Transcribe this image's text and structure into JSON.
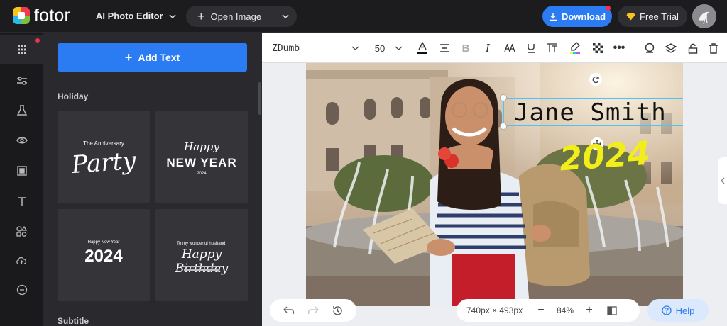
{
  "app": {
    "logo_text": "fotor",
    "editor_menu": "AI Photo Editor"
  },
  "header": {
    "open_image": "Open Image",
    "download": "Download",
    "free_trial": "Free Trial"
  },
  "panel": {
    "add_text": "Add Text",
    "section_holiday": "Holiday",
    "section_subtitle": "Subtitle",
    "cards": [
      {
        "line1": "The Anniversary",
        "line2": "Party"
      },
      {
        "line1": "Happy",
        "line2": "NEW YEAR",
        "line3": "2024"
      },
      {
        "line1": "Happy New Year",
        "line2": "2024"
      },
      {
        "line1": "To my wonderful husband,",
        "line2": "Happy Birthday"
      }
    ]
  },
  "toolbar": {
    "font_name": "ZDumb",
    "font_size": "50"
  },
  "canvas": {
    "text_name": "Jane Smith",
    "text_year": "2024",
    "dimensions": "740px × 493px",
    "zoom": "84%"
  },
  "help": "Help",
  "colors": {
    "accent": "#2b7bf3",
    "year_text": "#f2ee1a",
    "selection": "#4fc3f7"
  }
}
